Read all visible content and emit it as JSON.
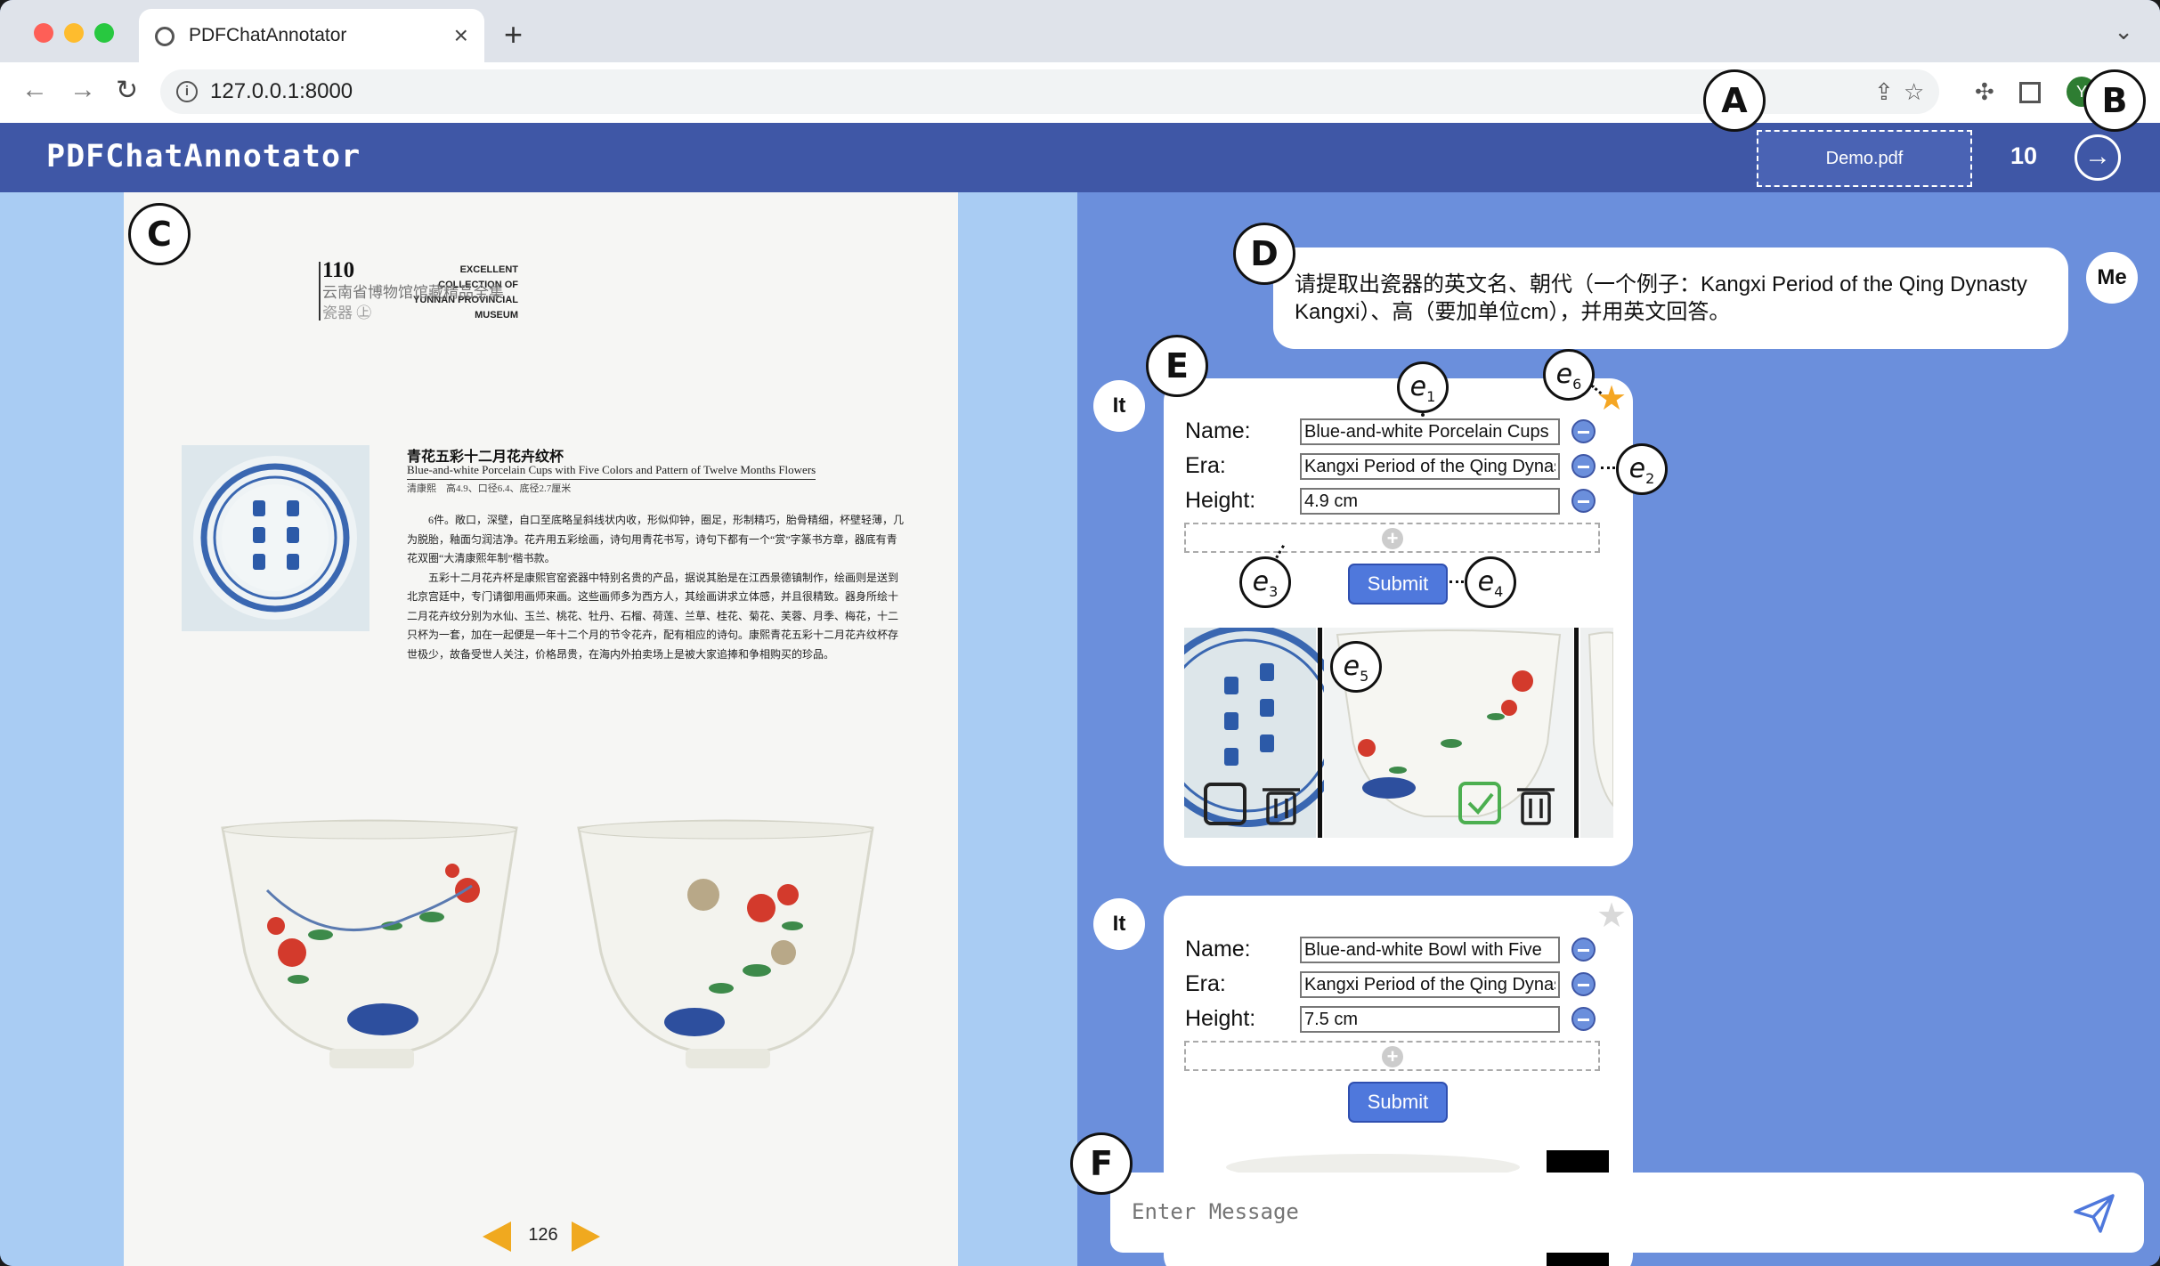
{
  "browser": {
    "tab_title": "PDFChatAnnotator",
    "url": "127.0.0.1:8000",
    "profile_initial": "Y"
  },
  "app": {
    "title": "PDFChatAnnotator",
    "file_name": "Demo.pdf",
    "page_count": "10"
  },
  "pdf": {
    "book_header": [
      "EXCELLENT",
      "COLLECTION OF",
      "YUNNAN PROVINCIAL",
      "MUSEUM"
    ],
    "book_number": "110",
    "book_subtitle": "云南省博物馆馆藏精品全集",
    "book_volume": "瓷器 ㊤",
    "item_title_cn": "青花五彩十二月花卉纹杯",
    "item_title_en": "Blue-and-white Porcelain Cups with Five Colors and Pattern of Twelve Months Flowers",
    "item_meta": "清康熙　高4.9、口径6.4、底径2.7厘米",
    "body_p1": "6件。敞口，深壁，自口至底略呈斜线状内收，形似仰钟，圈足，形制精巧，胎骨精细，杯壁轻薄，几为脱胎，釉面匀润洁净。花卉用五彩绘画，诗句用青花书写，诗句下都有一个“赏”字篆书方章，器底有青花双圈“大清康熙年制”楷书款。",
    "body_p2": "五彩十二月花卉杯是康熙官窑瓷器中特别名贵的产品，据说其胎是在江西景德镇制作，绘画则是送到北京宫廷中，专门请御用画师来画。这些画师多为西方人，其绘画讲求立体感，并且很精致。器身所绘十二月花卉纹分别为水仙、玉兰、桃花、牡丹、石榴、荷莲、兰草、桂花、菊花、芙蓉、月季、梅花，十二只杯为一套，加在一起便是一年十二个月的节令花卉，配有相应的诗句。康熙青花五彩十二月花卉纹杯存世极少，故备受世人关注，价格昂贵，在海内外拍卖场上是被大家追捧和争相购买的珍品。",
    "current_page": "126"
  },
  "chat": {
    "user_avatar": "Me",
    "user_message": "请提取出瓷器的英文名、朝代（一个例子：Kangxi Period of the Qing Dynasty Kangxi）、高（要加单位cm），并用英文回答。",
    "bot_avatar": "It",
    "field_labels": {
      "name": "Name:",
      "era": "Era:",
      "height": "Height:"
    },
    "submit_label": "Submit",
    "cards": [
      {
        "name": "Blue-and-white Porcelain Cups",
        "era": "Kangxi Period of the Qing Dynasty",
        "height": "4.9 cm",
        "starred": true
      },
      {
        "name": "Blue-and-white Bowl with Five",
        "era": "Kangxi Period of the Qing Dynasty",
        "height": "7.5 cm",
        "starred": false
      }
    ],
    "input_placeholder": "Enter Message"
  },
  "callouts": {
    "A": "A",
    "B": "B",
    "C": "C",
    "D": "D",
    "E": "E",
    "F": "F",
    "e_letter": "e",
    "e1": "1",
    "e2": "2",
    "e3": "3",
    "e4": "4",
    "e5": "5",
    "e6": "6"
  },
  "colors": {
    "header": "#3f57a6",
    "chat_bg": "#6b8fdc",
    "pdf_bg": "#a9ccf3",
    "submit": "#4f78dc",
    "star_active": "#f5a623",
    "star_inactive": "#d9d9d9",
    "check": "#4caf50"
  },
  "icons": [
    "back-icon",
    "forward-icon",
    "reload-icon",
    "info-icon",
    "share-icon",
    "bookmark-star-icon",
    "extensions-icon",
    "sidepanel-icon",
    "arrow-right-icon",
    "minus-icon",
    "plus-icon",
    "star-icon",
    "checkbox-icon",
    "trash-icon",
    "send-icon",
    "prev-page-icon",
    "next-page-icon"
  ]
}
